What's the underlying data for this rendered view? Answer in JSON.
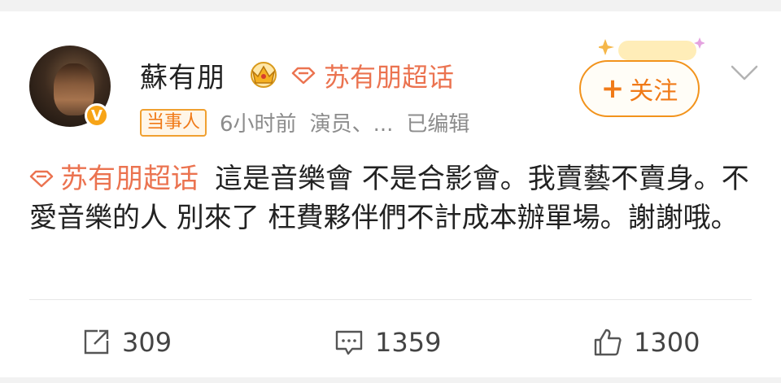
{
  "post": {
    "author": {
      "name": "蘇有朋",
      "verified_mark": "V",
      "crown": "crown-icon"
    },
    "super_topic": "苏有朋超话",
    "meta": {
      "badge": "当事人",
      "time": "6小时前",
      "source": "演员、...",
      "edited": "已编辑"
    },
    "follow_button": {
      "plus": "+",
      "label": "关注"
    },
    "content": {
      "topic": "苏有朋超话",
      "text": "這是音樂會 不是合影會。我賣藝不賣身。不愛音樂的人 別來了 枉費夥伴們不計成本辦單場。謝謝哦。"
    },
    "actions": {
      "share_count": "309",
      "comment_count": "1359",
      "like_count": "1300"
    }
  },
  "colors": {
    "accent": "#eb7350",
    "follow": "#f07a18",
    "verified": "#f7a417",
    "text": "#222222",
    "meta": "#8c8c8c"
  }
}
